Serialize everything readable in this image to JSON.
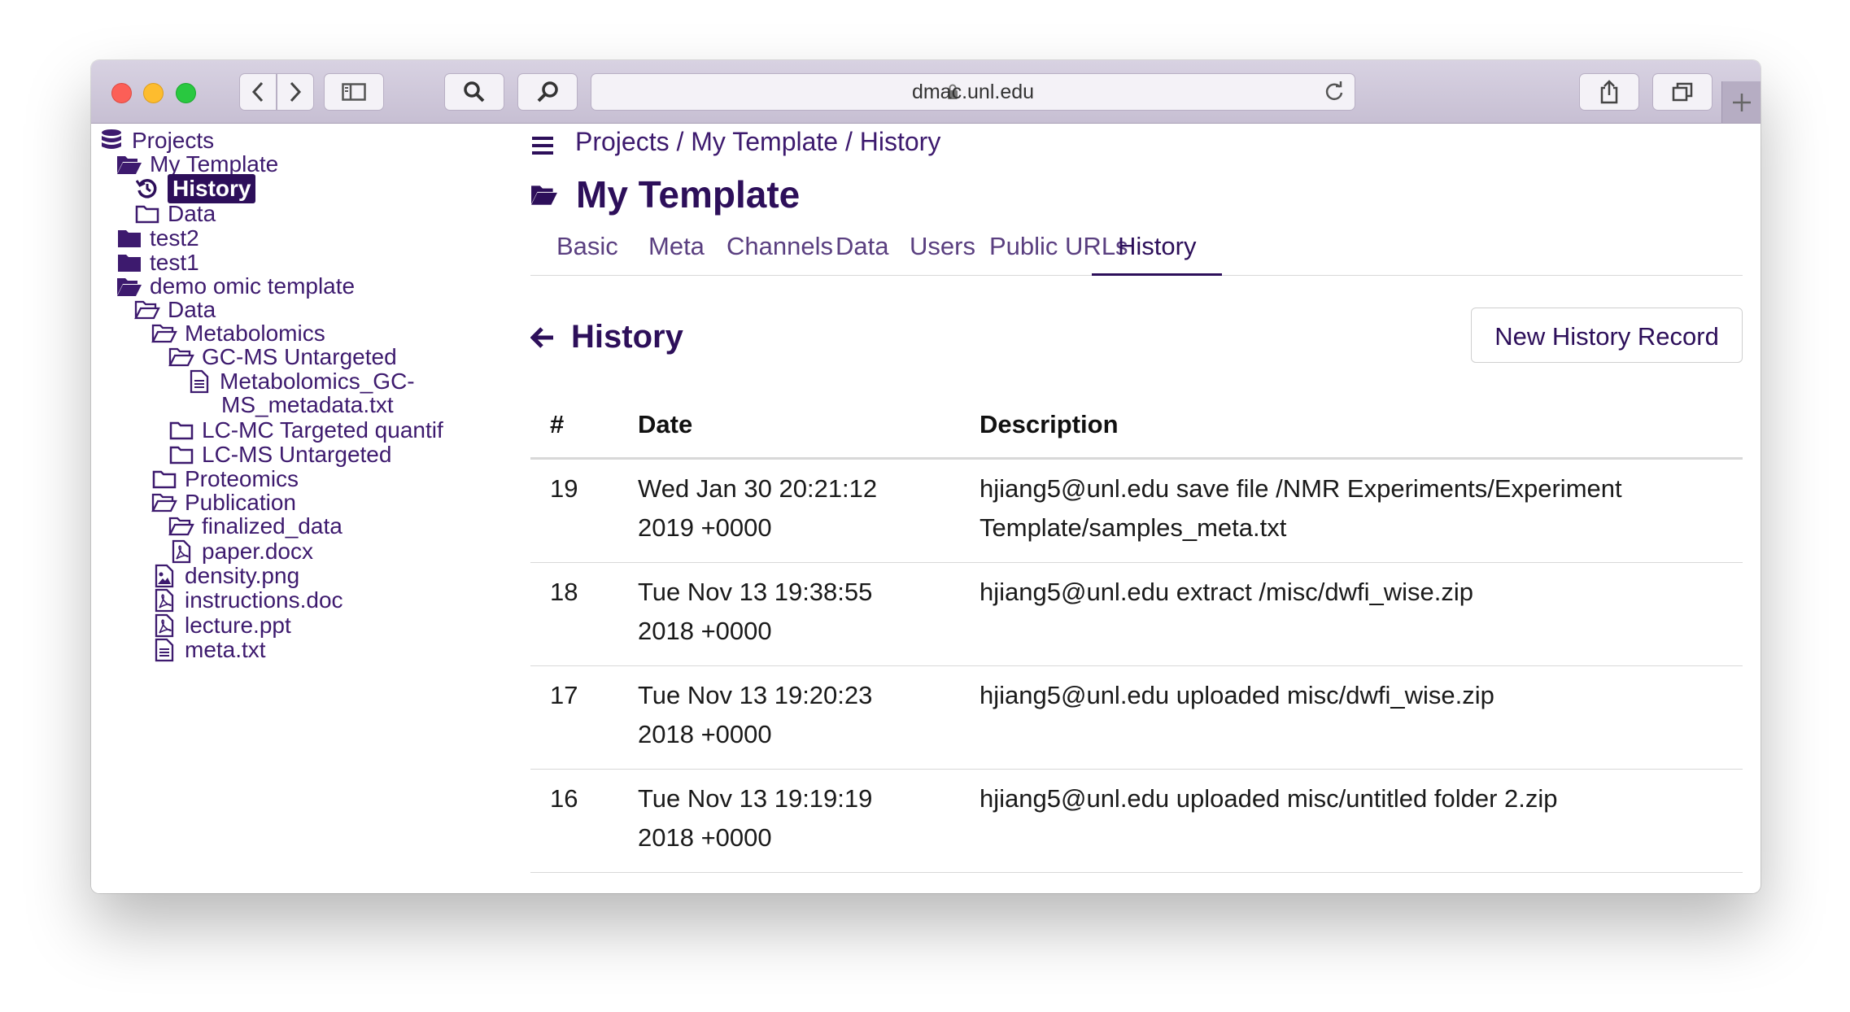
{
  "browser": {
    "url": "dmac.unl.edu"
  },
  "sidebar": {
    "items": [
      {
        "label": "Projects",
        "icon": "database-icon"
      },
      {
        "label": "My Template",
        "icon": "folder-open-icon"
      },
      {
        "label": "History",
        "icon": "history-icon",
        "selected": true
      },
      {
        "label": "Data",
        "icon": "folder-outline-icon"
      },
      {
        "label": "test2",
        "icon": "folder-icon"
      },
      {
        "label": "test1",
        "icon": "folder-icon"
      },
      {
        "label": "demo omic template",
        "icon": "folder-open-icon"
      },
      {
        "label": "Data",
        "icon": "folder-open-outline-icon"
      },
      {
        "label": "Metabolomics",
        "icon": "folder-open-outline-icon"
      },
      {
        "label": "GC-MS Untargeted",
        "icon": "folder-open-outline-icon"
      },
      {
        "label": "Metabolomics_GC-",
        "icon": "file-text-icon"
      },
      {
        "label": "MS_metadata.txt",
        "icon": ""
      },
      {
        "label": "LC-MC Targeted quantif",
        "icon": "folder-outline-icon"
      },
      {
        "label": "LC-MS Untargeted",
        "icon": "folder-outline-icon"
      },
      {
        "label": "Proteomics",
        "icon": "folder-outline-icon"
      },
      {
        "label": "Publication",
        "icon": "folder-open-outline-icon"
      },
      {
        "label": "finalized_data",
        "icon": "folder-open-outline-icon"
      },
      {
        "label": "paper.docx",
        "icon": "file-pdf-icon"
      },
      {
        "label": "density.png",
        "icon": "file-image-icon"
      },
      {
        "label": "instructions.doc",
        "icon": "file-pdf-icon"
      },
      {
        "label": "lecture.ppt",
        "icon": "file-pdf-icon"
      },
      {
        "label": "meta.txt",
        "icon": "file-text-icon"
      }
    ]
  },
  "breadcrumb": {
    "part1": "Projects",
    "sep1": " / ",
    "part2": "My Template",
    "sep2": " / ",
    "part3": "History"
  },
  "page": {
    "title": "My Template",
    "section_title": "History",
    "new_button": "New History Record"
  },
  "tabs": [
    "Basic",
    "Meta",
    "Channels",
    "Data",
    "Users",
    "Public URLs",
    "History"
  ],
  "active_tab": "History",
  "table": {
    "headers": [
      "#",
      "Date",
      "Description"
    ],
    "rows": [
      {
        "num": "19",
        "date1": "Wed Jan 30 20:21:12",
        "date2": "2019 +0000",
        "desc1": "hjiang5@unl.edu save file /NMR Experiments/Experiment",
        "desc2": "Template/samples_meta.txt"
      },
      {
        "num": "18",
        "date1": "Tue Nov 13 19:38:55",
        "date2": "2018 +0000",
        "desc1": "hjiang5@unl.edu extract /misc/dwfi_wise.zip",
        "desc2": ""
      },
      {
        "num": "17",
        "date1": "Tue Nov 13 19:20:23",
        "date2": "2018 +0000",
        "desc1": "hjiang5@unl.edu uploaded misc/dwfi_wise.zip",
        "desc2": ""
      },
      {
        "num": "16",
        "date1": "Tue Nov 13 19:19:19",
        "date2": "2018 +0000",
        "desc1": "hjiang5@unl.edu uploaded misc/untitled folder 2.zip",
        "desc2": ""
      }
    ]
  },
  "colors": {
    "brand": "#2d0f5a",
    "link": "#3d1a6e",
    "toolbar": "#cfc8da"
  }
}
